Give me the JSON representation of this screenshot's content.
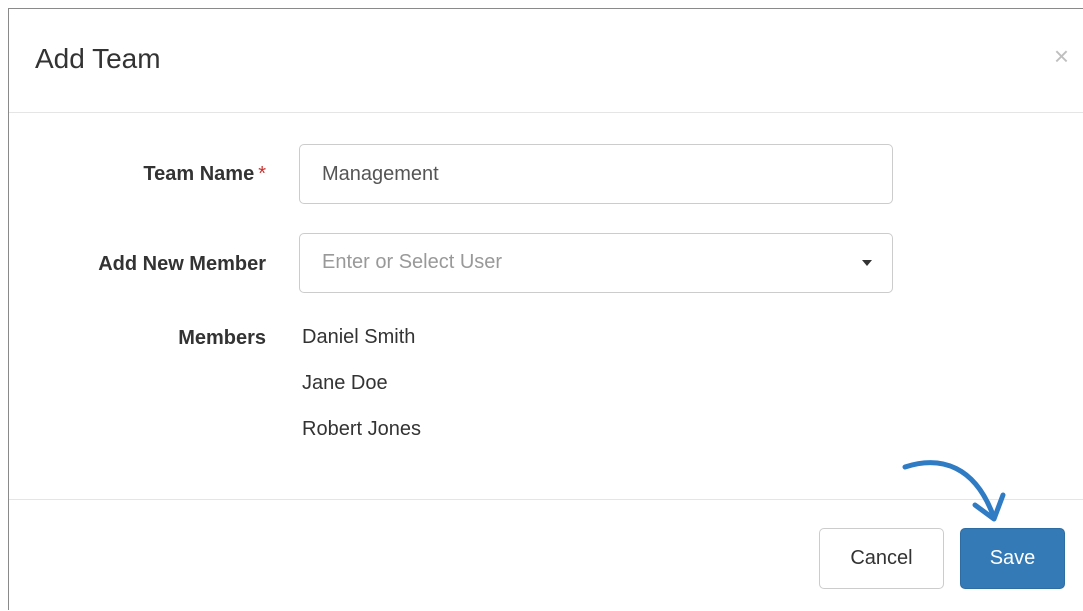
{
  "modal": {
    "title": "Add Team",
    "close_symbol": "×"
  },
  "form": {
    "team_name": {
      "label": "Team Name",
      "required_marker": "*",
      "value": "Management"
    },
    "add_member": {
      "label": "Add New Member",
      "placeholder": "Enter or Select User"
    },
    "members": {
      "label": "Members",
      "items": [
        "Daniel Smith",
        "Jane Doe",
        "Robert Jones"
      ]
    }
  },
  "footer": {
    "cancel_label": "Cancel",
    "save_label": "Save"
  },
  "colors": {
    "primary": "#337ab7",
    "required": "#c9302c",
    "annotation_arrow": "#2f7bc4"
  },
  "icons": {
    "close": "close-icon",
    "dropdown": "caret-down-icon",
    "annotation": "curved-arrow-icon"
  }
}
